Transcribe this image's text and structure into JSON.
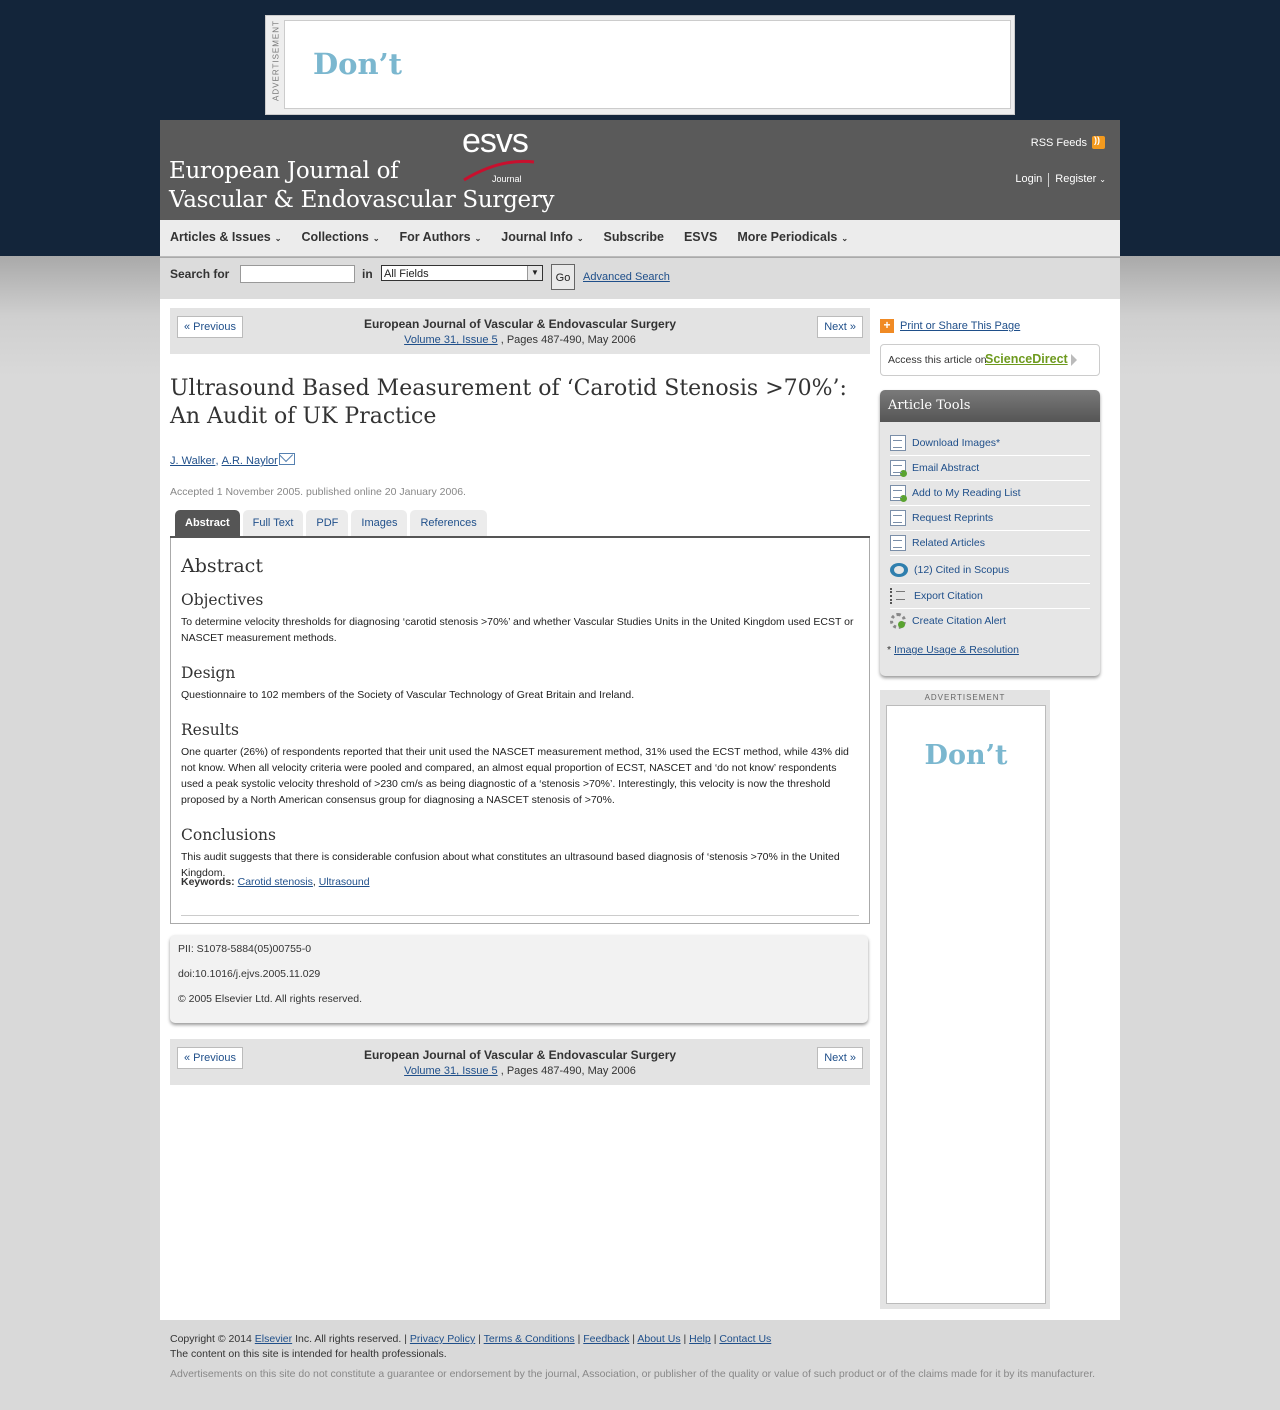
{
  "top_ad": {
    "label": "ADVERTISEMENT",
    "text": "Don’t"
  },
  "header": {
    "logo_line1": "European Journal of",
    "logo_line2": "Vascular & Endovascular Surgery",
    "esvs": "esvs",
    "esvs_sub": "Journal",
    "rss": "RSS Feeds",
    "login": "Login",
    "register": "Register"
  },
  "nav": {
    "items": [
      {
        "label": "Articles & Issues",
        "dropdown": true
      },
      {
        "label": "Collections",
        "dropdown": true
      },
      {
        "label": "For Authors",
        "dropdown": true
      },
      {
        "label": "Journal Info",
        "dropdown": true
      },
      {
        "label": "Subscribe",
        "dropdown": false
      },
      {
        "label": "ESVS",
        "dropdown": false
      },
      {
        "label": "More Periodicals",
        "dropdown": true
      }
    ]
  },
  "search": {
    "label": "Search for",
    "in_label": "in",
    "value": "",
    "field": "All Fields",
    "go": "Go",
    "advanced": "Advanced Search"
  },
  "article_nav": {
    "prev": "« Previous",
    "next": "Next »",
    "journal": "European Journal of Vascular & Endovascular Surgery",
    "volume_link": "Volume 31, Issue 5",
    "pages": ", Pages 487-490, May 2006"
  },
  "article": {
    "title": "Ultrasound Based Measurement of ‘Carotid Stenosis >70%’: An Audit of UK Practice",
    "authors": [
      "J. Walker",
      "A.R. Naylor"
    ],
    "dates": "Accepted 1 November 2005. published online 20 January 2006."
  },
  "tabs": [
    "Abstract",
    "Full Text",
    "PDF",
    "Images",
    "References"
  ],
  "abstract": {
    "heading": "Abstract",
    "objectives_h": "Objectives",
    "objectives": "To determine velocity thresholds for diagnosing ‘carotid stenosis >70%’ and whether Vascular Studies Units in the United Kingdom used ECST or NASCET measurement methods.",
    "design_h": "Design",
    "design": "Questionnaire to 102 members of the Society of Vascular Technology of Great Britain and Ireland.",
    "results_h": "Results",
    "results": "One quarter (26%) of respondents reported that their unit used the NASCET measurement method, 31% used the ECST method, while 43% did not know. When all velocity criteria were pooled and compared, an almost equal proportion of ECST, NASCET and ‘do not know’ respondents used a peak systolic velocity threshold of >230 cm/s as being diagnostic of a ‘stenosis >70%’. Interestingly, this velocity is now the threshold proposed by a North American consensus group for diagnosing a NASCET stenosis of >70%.",
    "conclusions_h": "Conclusions",
    "conclusions": "This audit suggests that there is considerable confusion about what constitutes an ultrasound based diagnosis of ‘stenosis >70% in the United Kingdom.",
    "keywords_label": "Keywords:",
    "keywords": [
      "Carotid stenosis",
      "Ultrasound"
    ]
  },
  "pii": {
    "pii": "PII: S1078-5884(05)00755-0",
    "doi": "doi:10.1016/j.ejvs.2005.11.029",
    "copyright": "© 2005 Elsevier Ltd. All rights reserved."
  },
  "sidebar": {
    "share": "Print or Share This Page",
    "access": "Access this article on",
    "sciencedirect": "ScienceDirect",
    "tools_title": "Article Tools",
    "tools": [
      {
        "label": "Download Images*",
        "icon": "download-images-icon"
      },
      {
        "label": "Email Abstract",
        "icon": "email-icon"
      },
      {
        "label": "Add to My Reading List",
        "icon": "reading-list-icon"
      },
      {
        "label": "Request Reprints",
        "icon": "reprints-icon"
      },
      {
        "label": "Related Articles",
        "icon": "related-articles-icon"
      },
      {
        "label": "(12) Cited in Scopus",
        "icon": "scopus-icon"
      },
      {
        "label": "Export Citation",
        "icon": "export-citation-icon"
      },
      {
        "label": "Create Citation Alert",
        "icon": "citation-alert-icon"
      }
    ],
    "usage_star": "*",
    "usage": "Image Usage & Resolution",
    "ad_label": "ADVERTISEMENT",
    "ad_text": "Don’t"
  },
  "footer": {
    "copyright": "Copyright © 2014",
    "elsevier": "Elsevier",
    "rights": "Inc. All rights reserved.",
    "links": [
      "Privacy Policy",
      "Terms & Conditions",
      "Feedback",
      "About Us",
      "Help",
      "Contact Us"
    ],
    "health": "The content on this site is intended for health professionals.",
    "disclaimer": "Advertisements on this site do not constitute a guarantee or endorsement by the journal, Association, or publisher of the quality or value of such product or of the claims made for it by its manufacturer."
  }
}
